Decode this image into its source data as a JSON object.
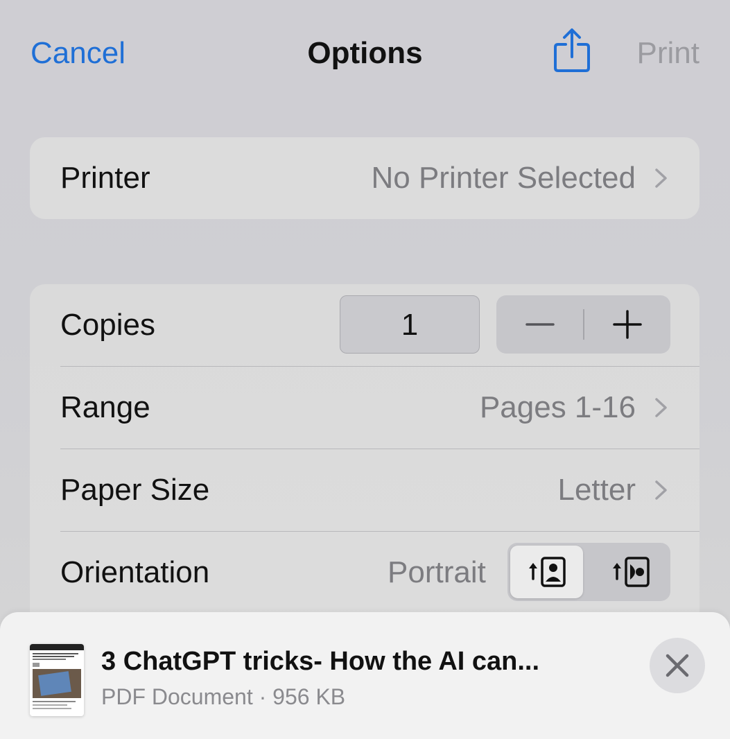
{
  "nav": {
    "cancel_label": "Cancel",
    "title": "Options",
    "share_icon": "share-icon",
    "print_label": "Print",
    "accent_color": "#1f6fd6"
  },
  "printer": {
    "label": "Printer",
    "value": "No Printer Selected"
  },
  "copies": {
    "label": "Copies",
    "value": "1"
  },
  "range": {
    "label": "Range",
    "value": "Pages 1-16"
  },
  "paper_size": {
    "label": "Paper Size",
    "value": "Letter"
  },
  "orientation": {
    "label": "Orientation",
    "value": "Portrait",
    "options": [
      "Portrait",
      "Landscape"
    ],
    "selected": "Portrait"
  },
  "document": {
    "title": "3 ChatGPT tricks- How the AI can...",
    "subtitle": "PDF Document · 956 KB"
  }
}
